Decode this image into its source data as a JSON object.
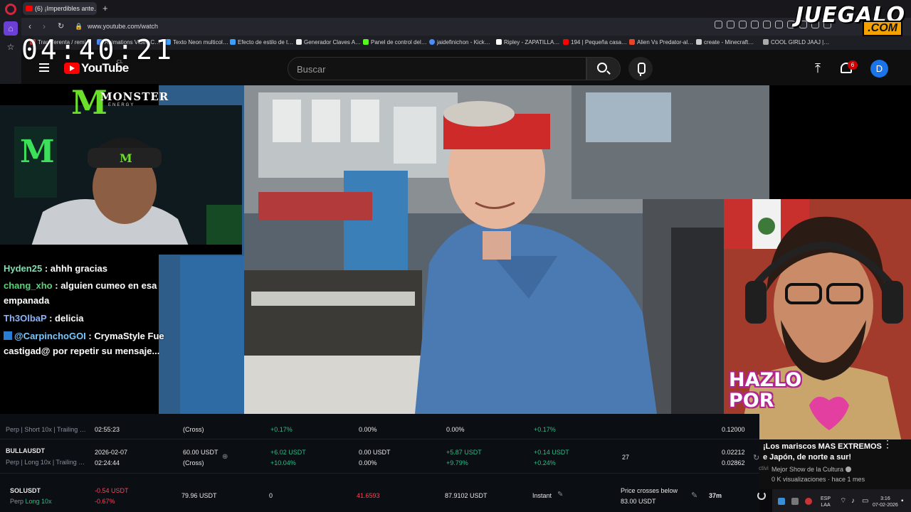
{
  "browser": {
    "tab_title": "(6) ¡Imperdibles ante…",
    "url": "www.youtube.com/watch",
    "bookmarks": [
      "Transferenta / remi…",
      "Animations Video C…",
      "Texto Neon multicol…",
      "Efecto de estilo de t…",
      "Generador Claves A…",
      "Panel de control del…",
      "jaidefinichon - Kick…",
      "Ripley - ZAPATILLA…",
      "194 | Pequeña casa…",
      "Alien Vs Predator-al…",
      "create - Minecraft…",
      "COOL GIRLD JAAJ |…"
    ]
  },
  "overlay": {
    "clock": "04:40:21",
    "brand_main": "JUEGALO",
    "brand_sub": ".COM",
    "monster_word": "MONSTER",
    "monster_sub": "ENERGY",
    "hazlo_line1": "HAZLO",
    "hazlo_line2": "POR"
  },
  "youtube": {
    "logo": "YouTube",
    "region": "CL",
    "search_placeholder": "Buscar",
    "notification_count": "6",
    "avatar_letter": "D"
  },
  "chat": {
    "messages": [
      {
        "user": "Hyden25",
        "text": ": ahhh gracias"
      },
      {
        "user": "chang_xho",
        "text": ": alguien cumeo en esa"
      },
      {
        "user": "",
        "text": "empanada"
      },
      {
        "user": "Th3OlbaP",
        "text": ": delicia"
      },
      {
        "user": "@CarpinchoGOI",
        "text": ": CrymaStyle Fue"
      },
      {
        "user": "",
        "text": "castigad@ por repetir su mensaje..."
      }
    ]
  },
  "up_next": {
    "title_line1": "¡Los mariscos MAS EXTREMOS",
    "title_line2": "e Japón, de norte a sur!",
    "channel": "Mejor Show de la Cultura",
    "stats": "0 K visualizaciones · hace 1 mes",
    "activity": "ctivi"
  },
  "positions": {
    "row0": {
      "sub": "Perp | Short 10x | Trailing …",
      "time": "02:55:23",
      "margin_mode": "(Cross)",
      "pnl_pct": "+0.17%",
      "fee_pct": "0.00%",
      "funding_pct": "0.00%",
      "total_pct": "+0.17%",
      "price": "0.12000"
    },
    "row1": {
      "symbol": "BULLAUSDT",
      "sub": "Perp | Long 10x | Trailing …",
      "date": "2026-02-07",
      "time": "02:24:44",
      "margin": "60.00 USDT",
      "margin_mode": "(Cross)",
      "pnl": "+6.02 USDT",
      "pnl_pct": "+10.04%",
      "fee": "0.00 USDT",
      "fee_pct": "0.00%",
      "funding": "+5.87 USDT",
      "funding_pct": "+9.79%",
      "total": "+0.14 USDT",
      "total_pct": "+0.24%",
      "count": "27",
      "price1": "0.02212",
      "price2": "0.02862"
    },
    "row2": {
      "symbol": "SOLUSDT",
      "sub_a": "Perp",
      "sub_b": "Long 10x",
      "pnl": "-0.54 USDT",
      "pnl_pct": "-0.67%",
      "size": "79.96 USDT",
      "qty": "0",
      "entry": "41.6593",
      "value": "87.9102 USDT",
      "mode": "Instant",
      "trigger_label": "Price crosses below",
      "trigger_value": "83.00 USDT",
      "duration": "37m"
    }
  },
  "taskbar": {
    "lang": "ESP",
    "lang2": "LAA",
    "time": "3:16",
    "date": "07-02-2026"
  },
  "colors": {
    "opera_red": "#d3253c",
    "youtube_red": "#ff0000",
    "monster_green": "#6be02a",
    "profit_green": "#2ebd85",
    "loss_red": "#f6465d",
    "juegalo_orange": "#f5a100"
  }
}
